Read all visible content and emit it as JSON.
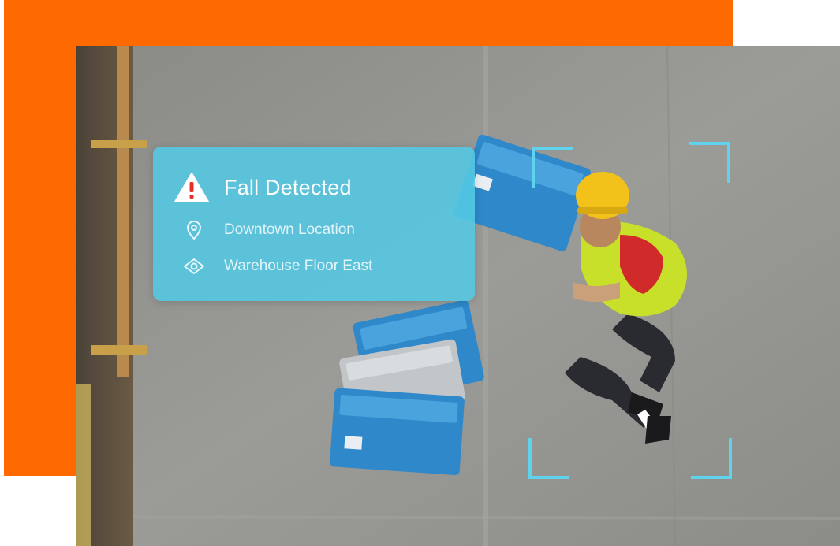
{
  "alert": {
    "title": "Fall Detected",
    "location": "Downtown Location",
    "area": "Warehouse Floor East",
    "icons": {
      "title": "warning-triangle-icon",
      "location": "map-pin-icon",
      "area": "eye-icon"
    }
  },
  "colors": {
    "accent": "#ff6a00",
    "card": "#54c8e4",
    "bracket": "#5fd3ee",
    "crate": "#2f88c9",
    "helmet": "#f2c21a",
    "vest": "#c8e02a"
  }
}
